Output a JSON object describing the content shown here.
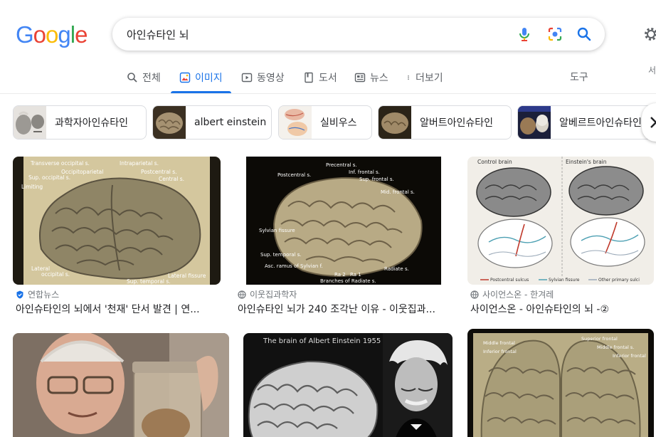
{
  "header": {
    "logo_letters": [
      {
        "char": "G",
        "color": "#4285F4"
      },
      {
        "char": "o",
        "color": "#EA4335"
      },
      {
        "char": "o",
        "color": "#FBBC05"
      },
      {
        "char": "g",
        "color": "#4285F4"
      },
      {
        "char": "l",
        "color": "#34A853"
      },
      {
        "char": "e",
        "color": "#EA4335"
      }
    ],
    "search_query": "아인슈타인 뇌"
  },
  "tabs": {
    "all": "전체",
    "images": "이미지",
    "videos": "동영상",
    "books": "도서",
    "news": "뉴스",
    "more": "더보기",
    "tools": "도구",
    "cut_right": "서"
  },
  "chips": [
    {
      "label": "과학자아인슈타인"
    },
    {
      "label": "albert einstein"
    },
    {
      "label": "실비우스"
    },
    {
      "label": "알버트아인슈타인"
    },
    {
      "label": "알베르트아인슈타인"
    }
  ],
  "results": [
    {
      "source": "연합뉴스",
      "title": "아인슈타인의 뇌에서 '천재' 단서 발견 | 연...",
      "verified": true,
      "img_labels": [
        "Transverse occipital s.",
        "Sup. occipital s.",
        "Occipitoparietal",
        "Intraparietal s.",
        "Postcentral s.",
        "Central s.",
        "Limiting",
        "Lateral",
        "occipital s.",
        "Sup. temporal s.",
        "Lateral fissure",
        "Inf. precentral"
      ]
    },
    {
      "source": "이웃집과학자",
      "title": "아인슈타인 뇌가 240 조각난 이유 - 이웃집과...",
      "verified": false,
      "img_labels": [
        "Precentral s.",
        "Inf. frontal s.",
        "Sup. frontal s.",
        "Postcentral s.",
        "Mid. frontal s.",
        "Sylvian fissure",
        "Sup. temporal s.",
        "Asc. ramus of Sylvian f.",
        "Ra 2",
        "Ra 1",
        "Radiate s.",
        "Branches of Radiate s."
      ]
    },
    {
      "source": "사이언스온 - 한겨레",
      "title": "사이언스온 - 아인슈타인의 뇌 -②",
      "verified": false,
      "img_labels": [
        "Control brain",
        "Einstein's brain",
        "Postcentral sulcus",
        "Sylvian fissure",
        "Other primary sulci"
      ]
    },
    {
      "img_labels": []
    },
    {
      "img_labels": [
        "The brain of Albert Einstein 1955"
      ]
    },
    {
      "img_labels": [
        "Middle frontal",
        "Inferior frontal",
        "Superior frontal",
        "Middle frontal s.",
        "Inferior frontal"
      ]
    }
  ],
  "colors": {
    "accent": "#1a73e8",
    "text_secondary": "#70757a",
    "verified_badge": "#1a73e8"
  },
  "icons": [
    "microphone-icon",
    "google-lens-icon",
    "search-icon",
    "settings-gear-icon",
    "chevron-right-icon"
  ]
}
